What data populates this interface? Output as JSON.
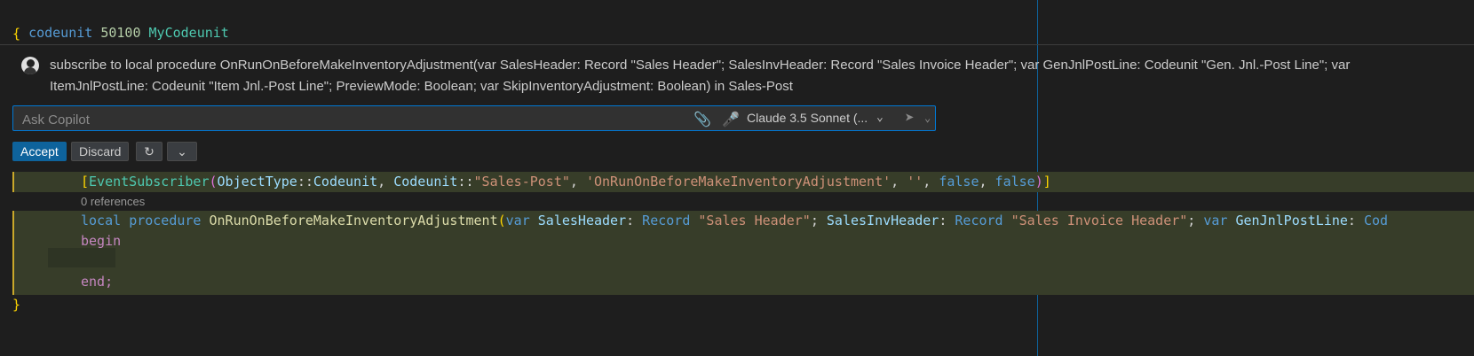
{
  "code": {
    "line1": {
      "kw": "codeunit",
      "num": "50100",
      "name": "MyCodeunit"
    },
    "open_brace": "{",
    "close_brace": "}",
    "attr": {
      "open": "[",
      "name": "EventSubscriber",
      "lparen": "(",
      "p1": "ObjectType",
      "sep1": "::",
      "p2": "Codeunit",
      "comma1": ", ",
      "p3": "Codeunit",
      "sep2": "::",
      "p4": "\"Sales-Post\"",
      "comma2": ", ",
      "p5": "'OnRunOnBeforeMakeInventoryAdjustment'",
      "comma3": ", ",
      "p6": "''",
      "comma4": ", ",
      "p7": "false",
      "comma5": ", ",
      "p8": "false",
      "rparen": ")",
      "close": "]"
    },
    "references": "0 references",
    "proc": {
      "kw1": "local",
      "kw2": "procedure",
      "name": "OnRunOnBeforeMakeInventoryAdjustment",
      "lparen": "(",
      "v1": "var",
      "p1": "SalesHeader",
      "c1": ": ",
      "t1": "Record",
      "s1": "\"Sales Header\"",
      "semi1": "; ",
      "p2": "SalesInvHeader",
      "c2": ": ",
      "t2": "Record",
      "s2": "\"Sales Invoice Header\"",
      "semi2": "; ",
      "v2": "var",
      "p3": "GenJnlPostLine",
      "c3": ": ",
      "t3": "Cod"
    },
    "begin": "begin",
    "end": "end;"
  },
  "copilot": {
    "prompt": "subscribe to local procedure OnRunOnBeforeMakeInventoryAdjustment(var SalesHeader: Record \"Sales Header\"; SalesInvHeader: Record \"Sales Invoice Header\"; var GenJnlPostLine: Codeunit \"Gen. Jnl.-Post Line\"; var ItemJnlPostLine: Codeunit \"Item Jnl.-Post Line\"; PreviewMode: Boolean; var SkipInventoryAdjustment: Boolean) in Sales-Post",
    "input_placeholder": "Ask Copilot",
    "model": "Claude 3.5 Sonnet (...",
    "icons": {
      "attach": "paperclip-icon",
      "mic": "microphone-icon",
      "send": "send-icon"
    }
  },
  "actions": {
    "accept": "Accept",
    "discard": "Discard"
  },
  "colors": {
    "background": "#1e1e1e",
    "accent": "#0e639c",
    "diff_added": "#373d29"
  }
}
